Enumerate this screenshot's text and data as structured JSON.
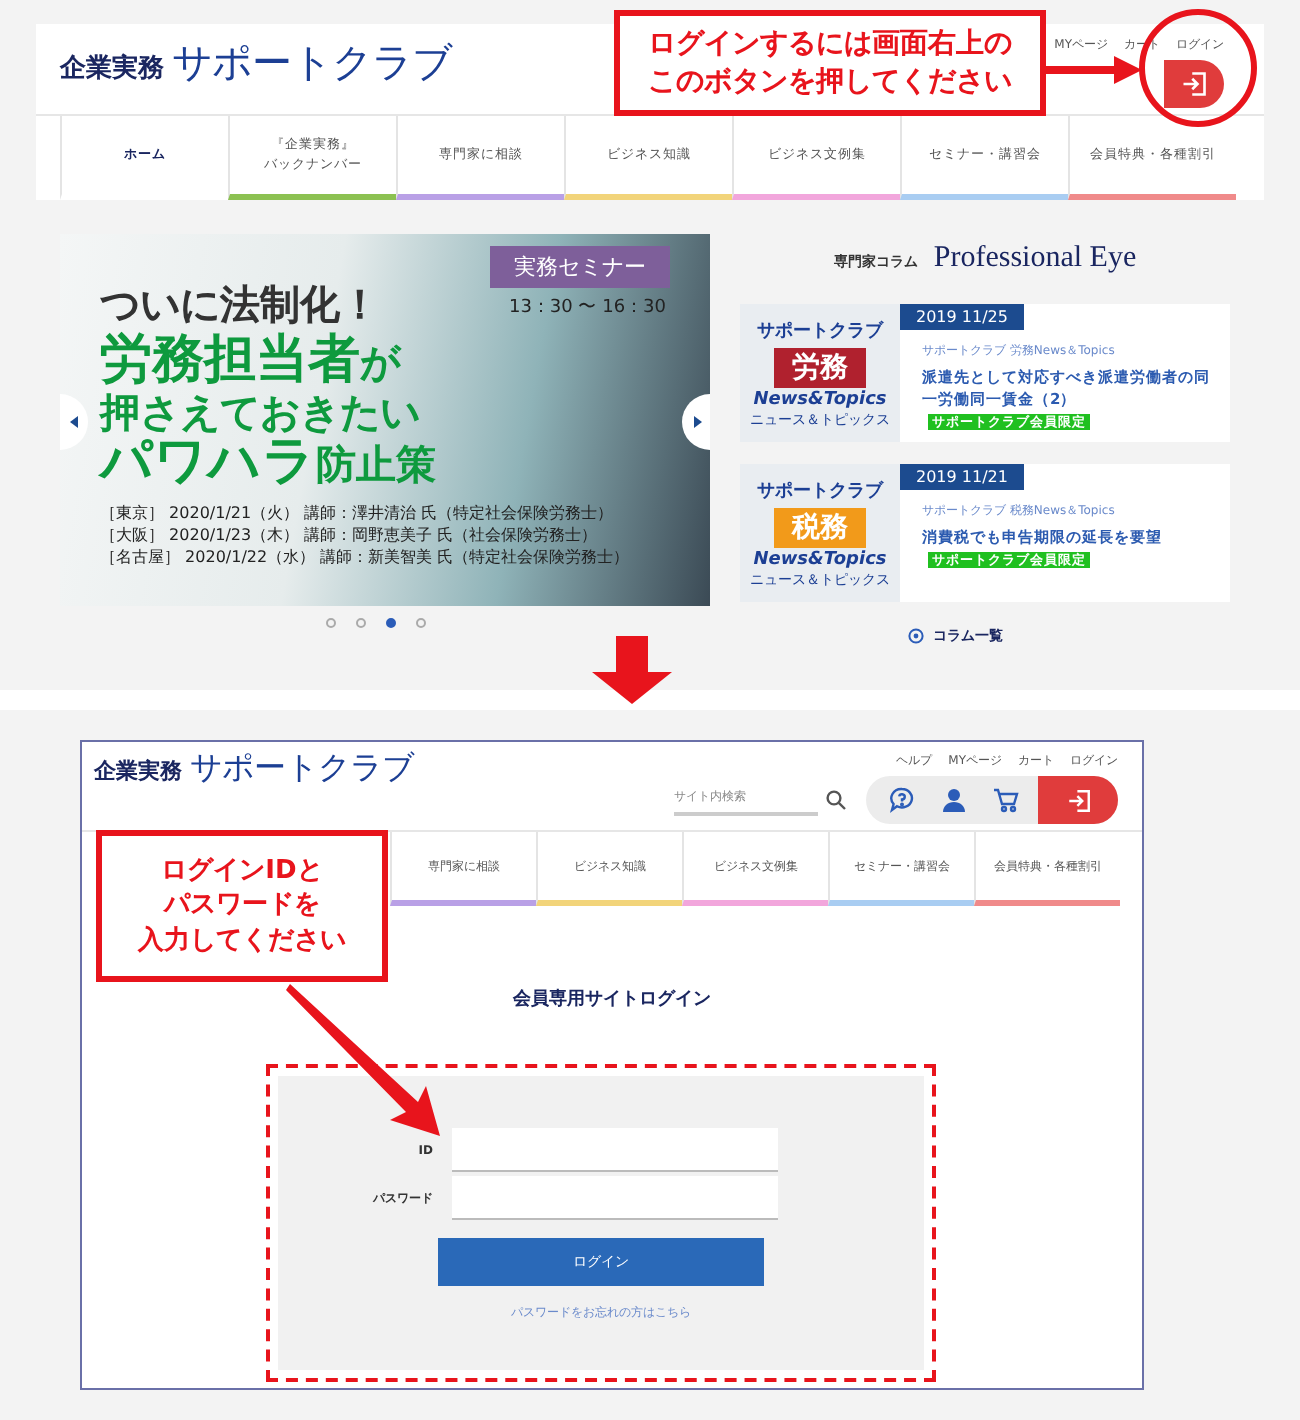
{
  "step_1": {
    "header": {
      "logo_small": "企業実務",
      "logo": "サポートクラブ",
      "top_links": [
        "MYページ",
        "カート",
        "ログイン"
      ]
    },
    "callout": [
      "ログインするには画面右上の",
      "このボタンを押してください"
    ],
    "nav_tabs": [
      {
        "label": "ホーム",
        "selected": true
      },
      {
        "label": [
          "『企業実務』",
          "バックナンバー"
        ],
        "selected": false,
        "color": "#8cc152"
      },
      {
        "label": "専門家に相談",
        "selected": false,
        "color": "#b9a0e6"
      },
      {
        "label": "ビジネス知識",
        "selected": false,
        "color": "#f2d47a"
      },
      {
        "label": "ビジネス文例集",
        "selected": false,
        "color": "#f2a6dc"
      },
      {
        "label": "セミナー・講習会",
        "selected": false,
        "color": "#a9cdf2"
      },
      {
        "label": "会員特典・各種割引",
        "selected": false,
        "color": "#f08a8a"
      }
    ],
    "banner": {
      "tag": "実務セミナー",
      "time": "13：30 〜 16：30",
      "headline": "ついに法制化！",
      "lines": [
        "**労務担当者**が",
        "押さえておきたい",
        "**パワハラ**防止策"
      ],
      "schedule": [
        {
          "city": "［東京］",
          "date": "2020/1/21（火）",
          "lecturer": "講師：澤井清治 氏（特定社会保険労務士）"
        },
        {
          "city": "［大阪］",
          "date": "2020/1/23（木）",
          "lecturer": "講師：岡野恵美子 氏（社会保険労務士）"
        },
        {
          "city": "［名古屋］",
          "date": "2020/1/22（水）",
          "lecturer": "講師：新美智美 氏（特定社会保険労務士）"
        }
      ]
    },
    "carousel_dots": [
      {
        "selected": false
      },
      {
        "selected": false
      },
      {
        "selected": true
      },
      {
        "selected": false
      }
    ],
    "column": {
      "label": "専門家コラム",
      "title": "Professional Eye",
      "more_link": "コラム一覧",
      "articles": [
        {
          "thumb": {
            "brand": "サポートクラブ",
            "topic": "労務",
            "color": "#b0212e",
            "logo": "News&Topics",
            "sub": "ニュース＆トピックス"
          },
          "date": "2019 11/25",
          "category": "サポートクラブ 労務News＆Topics",
          "title": "派遣先として対応すべき派遣労働者の同一労働同一賃金（2）",
          "badge": "サポートクラブ会員限定"
        },
        {
          "thumb": {
            "brand": "サポートクラブ",
            "topic": "税務",
            "color": "#f29a1a",
            "logo": "News&Topics",
            "sub": "ニュース＆トピックス"
          },
          "date": "2019 11/21",
          "category": "サポートクラブ 税務News＆Topics",
          "title": "消費税でも申告期限の延長を要望",
          "badge": "サポートクラブ会員限定"
        }
      ]
    }
  },
  "step_2": {
    "header": {
      "logo_small": "企業実務",
      "logo": "サポートクラブ",
      "top_links": [
        "ヘルプ",
        "MYページ",
        "カート",
        "ログイン"
      ],
      "search": {
        "placeholder": "サイト内検索"
      }
    },
    "nav_tabs": [
      {
        "label": "専門家に相談",
        "selected": false,
        "color": "#b9a0e6"
      },
      {
        "label": "ビジネス知識",
        "selected": false,
        "color": "#f2d47a"
      },
      {
        "label": "ビジネス文例集",
        "selected": false,
        "color": "#f2a6dc"
      },
      {
        "label": "セミナー・講習会",
        "selected": false,
        "color": "#a9cdf2"
      },
      {
        "label": "会員特典・各種割引",
        "selected": false,
        "color": "#f08a8a"
      }
    ],
    "callout": [
      "ログインIDと",
      "パスワードを",
      "入力してください"
    ],
    "page_title": "会員専用サイトログイン",
    "form": {
      "fields": [
        {
          "label": "ID"
        },
        {
          "label": "パスワード"
        }
      ],
      "submit": "ログイン",
      "forgot_link": "パスワードをお忘れの方はこちら"
    }
  }
}
